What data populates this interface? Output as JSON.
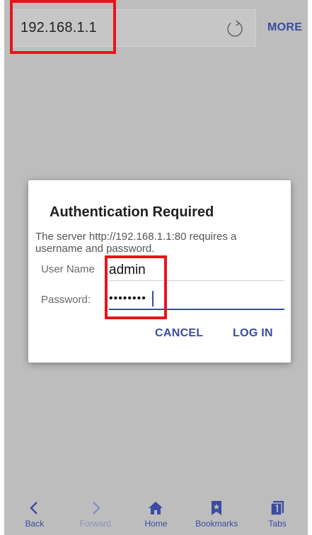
{
  "browser": {
    "url": "192.168.1.1",
    "more_label": "MORE"
  },
  "dialog": {
    "title": "Authentication Required",
    "message": "The server http://192.168.1.1:80 requires a username and password.",
    "username_label": "User Name",
    "username_value": "admin",
    "password_label": "Password:",
    "password_value": "••••••••",
    "cancel_label": "CANCEL",
    "login_label": "LOG IN"
  },
  "bottom_nav": {
    "items": [
      {
        "label": "Back",
        "icon": "chevron-left-icon"
      },
      {
        "label": "Forward",
        "icon": "chevron-right-icon"
      },
      {
        "label": "Home",
        "icon": "home-icon"
      },
      {
        "label": "Bookmarks",
        "icon": "bookmark-icon"
      },
      {
        "label": "Tabs",
        "icon": "tabs-icon"
      }
    ]
  },
  "colors": {
    "accent": "#3a4ba0",
    "highlight": "#e8141b",
    "background": "#bdbdbd"
  }
}
